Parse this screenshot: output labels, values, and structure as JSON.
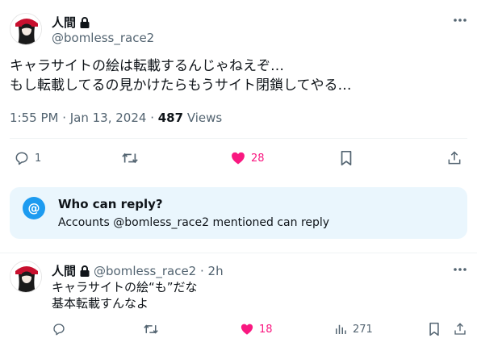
{
  "main_tweet": {
    "display_name": "人間",
    "handle": "@bomless_race2",
    "text_line1": "キャラサイトの絵は転載するんじゃねえぞ…",
    "text_line2": "もし転載してるの見かけたらもうサイト閉鎖してやる…",
    "timestamp": "1:55 PM · Jan 13, 2024 · ",
    "views_count": "487",
    "views_label": " Views",
    "reply_count": "1",
    "retweet_count": "",
    "like_count": "28"
  },
  "who_can_reply": {
    "title": "Who can reply?",
    "body": "Accounts @bomless_race2 mentioned can reply",
    "icon_glyph": "@"
  },
  "reply_tweet": {
    "display_name": "人間",
    "handle_time": "@bomless_race2 · 2h",
    "text_line1": "キャラサイトの絵“も”だな",
    "text_line2": "基本転載すんなよ",
    "reply_count": "",
    "retweet_count": "",
    "like_count": "18",
    "views_count": "271"
  },
  "colors": {
    "accent": "#1d9bf0",
    "like": "#f91880",
    "secondary_text": "#536471"
  }
}
